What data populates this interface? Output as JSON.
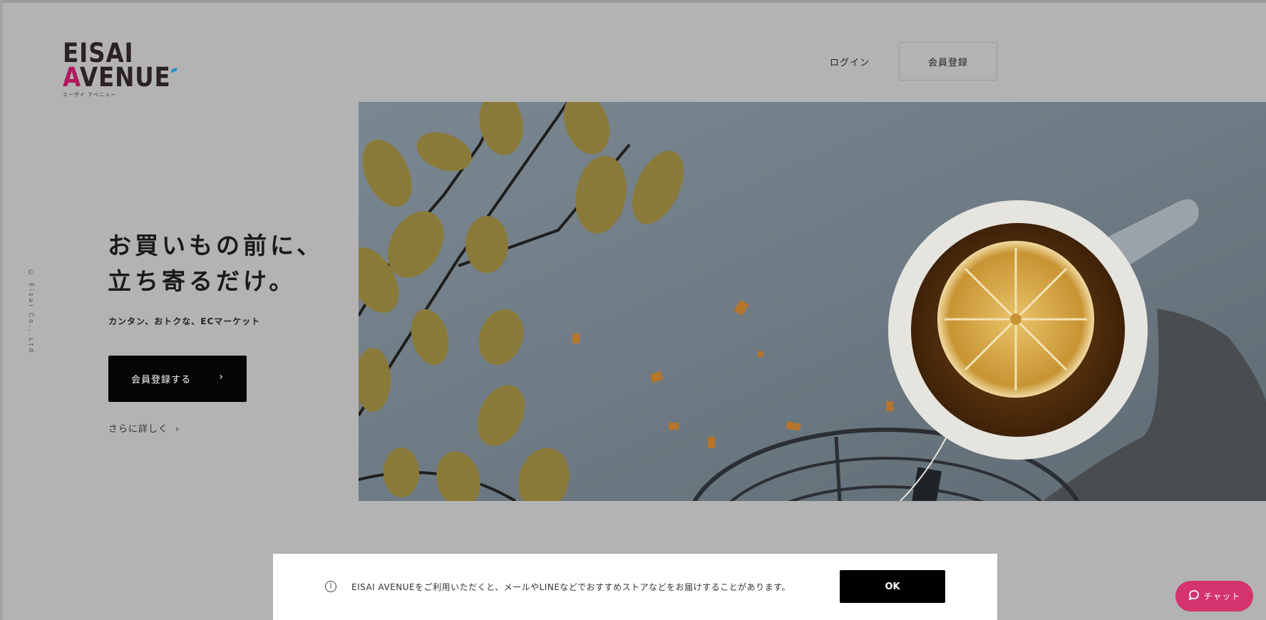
{
  "brand": {
    "logo_line1": "EISAI",
    "logo_line2_a": "A",
    "logo_line2_rest": "VENUE",
    "logo_sub": "エーザイ アベニュー",
    "colors": {
      "accent_pink": "#b0195d",
      "accent_blue": "#2f8fc9",
      "chat": "#d4336d"
    }
  },
  "header": {
    "login_label": "ログイン",
    "register_label": "会員登録"
  },
  "copyright": "© Eisai Co., Ltd.",
  "hero": {
    "title_line1": "お買いもの前に、",
    "title_line2": "立ち寄るだけ。",
    "subtitle": "カンタン、おトクな、ECマーケット",
    "cta_label": "会員登録する",
    "cta_icon": "chevron-right-icon",
    "more_label": "さらに詳しく",
    "image_alt": "tea-with-lemon-and-dried-leaves"
  },
  "cookie_banner": {
    "icon": "info-icon",
    "message": "EISAI AVENUEをご利用いただくと、メールやLINEなどでおすすめストアなどをお届けすることがあります。",
    "ok_label": "OK"
  },
  "chat": {
    "icon": "chat-bubble-icon",
    "label": "チャット"
  }
}
